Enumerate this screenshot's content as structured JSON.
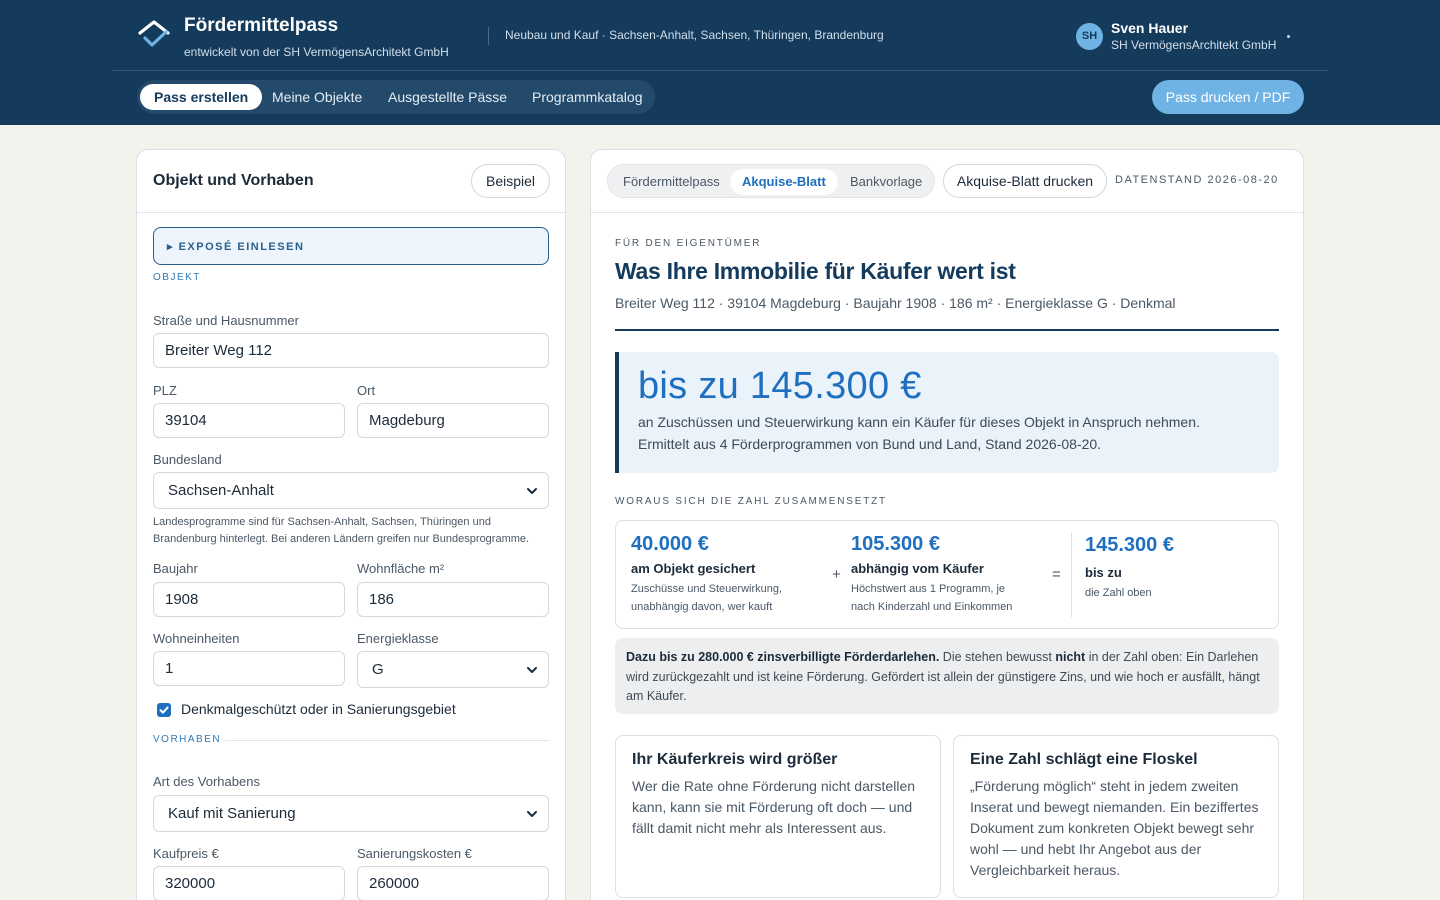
{
  "header": {
    "brand_title": "Fördermittelpass",
    "brand_subtitle": "entwickelt von der SH VermögensArchitekt GmbH",
    "scope": "Neubau und Kauf · Sachsen-Anhalt, Sachsen, Thüringen, Brandenburg",
    "user": {
      "initials": "SH",
      "name": "Sven Hauer",
      "company": "SH VermögensArchitekt GmbH"
    },
    "nav": [
      "Pass erstellen",
      "Meine Objekte",
      "Ausgestellte Pässe",
      "Programmkatalog"
    ],
    "print_label": "Pass drucken / PDF",
    "colors": {
      "header_bg": "#143a5c",
      "accent": "#6fb3e4",
      "link_blue": "#1f6fc0"
    }
  },
  "form": {
    "title": "Objekt und Vorhaben",
    "example_label": "Beispiel",
    "expose_label": "▸ EXPOSÉ EINLESEN",
    "section_object": "OBJEKT",
    "street_label": "Straße und Hausnummer",
    "street_value": "Breiter Weg 112",
    "plz_label": "PLZ",
    "plz_value": "39104",
    "city_label": "Ort",
    "city_value": "Magdeburg",
    "state_label": "Bundesland",
    "state_value": "Sachsen-Anhalt",
    "state_hint": "Landesprogramme sind für Sachsen-Anhalt, Sachsen, Thüringen und Brandenburg hinterlegt. Bei anderen Ländern greifen nur Bundesprogramme.",
    "year_label": "Baujahr",
    "year_value": "1908",
    "area_label": "Wohnfläche m²",
    "area_value": "186",
    "units_label": "Wohneinheiten",
    "units_value": "1",
    "energy_label": "Energieklasse",
    "energy_value": "G",
    "monument_label": "Denkmalgeschützt oder in Sanierungsgebiet",
    "monument_checked": true,
    "section_project": "VORHABEN",
    "type_label": "Art des Vorhabens",
    "type_value": "Kauf mit Sanierung",
    "price_label": "Kaufpreis €",
    "price_value": "320000",
    "reno_label": "Sanierungskosten €",
    "reno_value": "260000"
  },
  "preview": {
    "tabs": [
      "Fördermittelpass",
      "Akquise-Blatt",
      "Bankvorlage"
    ],
    "active_tab": "Akquise-Blatt",
    "print_label": "Akquise-Blatt drucken",
    "datenstand": "DATENSTAND 2026-08-20",
    "eyebrow": "FÜR DEN EIGENTÜMER",
    "headline": "Was Ihre Immobilie für Käufer wert ist",
    "meta": "Breiter Weg 112 · 39104 Magdeburg · Baujahr 1908 · 186 m² · Energieklasse G · Denkmal",
    "hero_amount": "bis zu 145.300 €",
    "hero_line1": "an Zuschüssen und Steuerwirkung kann ein Käufer für dieses Objekt in Anspruch nehmen.",
    "hero_line2": "Ermittelt aus 4 Förderprogrammen von Bund und Land, Stand 2026-08-20.",
    "breakdown_label": "WORAUS SICH DIE ZAHL ZUSAMMENSETZT",
    "secured_amount": "40.000 €",
    "secured_title": "am Objekt gesichert",
    "secured_desc1": "Zuschüsse und Steuerwirkung,",
    "secured_desc2": "unabhängig davon, wer kauft",
    "plus": "+",
    "buyer_amount": "105.300 €",
    "buyer_title": "abhängig vom Käufer",
    "buyer_desc1": "Höchstwert aus 1 Programm, je",
    "buyer_desc2": "nach Kinderzahl und Einkommen",
    "equals": "=",
    "total_amount": "145.300 €",
    "total_title": "bis zu",
    "total_desc": "die Zahl oben",
    "note_bold": "Dazu bis zu 280.000 € zinsverbilligte Förderdarlehen.",
    "note_text1": " Die stehen bewusst ",
    "note_bold2": "nicht",
    "note_text2": " in der Zahl oben: Ein Darlehen wird zurückgezahlt und ist keine Förderung. Gefördert ist allein der günstigere Zins, und wie hoch er ausfällt, hängt am Käufer.",
    "card1_title": "Ihr Käuferkreis wird größer",
    "card1_body": "Wer die Rate ohne Förderung nicht darstellen kann, kann sie mit Förderung oft doch — und fällt damit nicht mehr als Interessent aus.",
    "card2_title": "Eine Zahl schlägt eine Floskel",
    "card2_body": "„Förderung möglich“ steht in jedem zweiten Inserat und bewegt niemanden. Ein beziffertes Dokument zum konkreten Objekt bewegt sehr wohl — und hebt Ihr Angebot aus der Vergleichbarkeit heraus."
  }
}
